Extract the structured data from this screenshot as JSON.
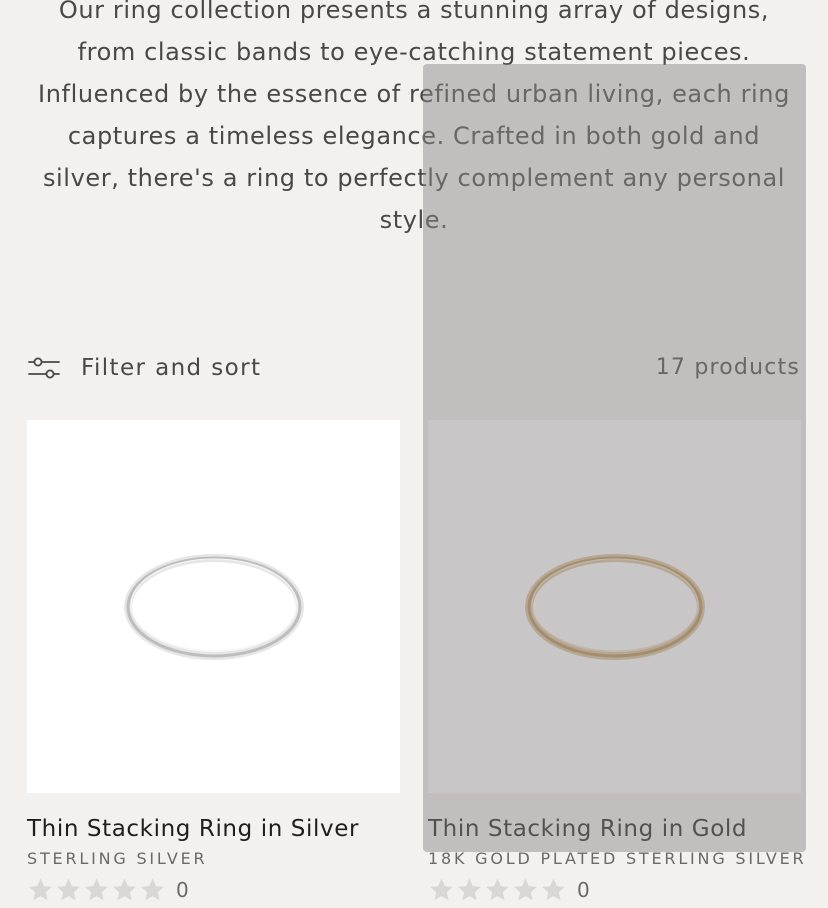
{
  "collection": {
    "description": "Our ring collection presents a stunning array of designs, from classic bands to eye-catching statement pieces. Influenced by the essence of refined urban living, each ring captures a timeless elegance. Crafted in both gold and silver, there's a ring to perfectly complement any personal style."
  },
  "toolbar": {
    "filter_label": "Filter and sort",
    "filter_icon": "filter-sliders-icon",
    "product_count": "17 products"
  },
  "products": [
    {
      "title": "Thin Stacking Ring in Silver",
      "vendor": "STERLING SILVER",
      "rating": 0,
      "review_count": "0",
      "metal_color": "#c9c9c9"
    },
    {
      "title": "Thin Stacking Ring in Gold",
      "vendor": "18K GOLD PLATED STERLING SILVER",
      "rating": 0,
      "review_count": "0",
      "metal_color": "#c9a46c"
    }
  ],
  "colors": {
    "background": "#f4f0ee",
    "text": "#4a4747",
    "star_empty": "#d9d6d5",
    "overlay": "rgba(140,135,135,0.48)"
  }
}
